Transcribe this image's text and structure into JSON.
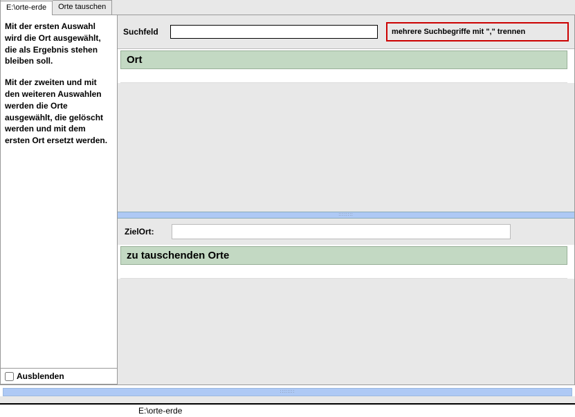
{
  "tabs": {
    "tab1": "E:\\orte-erde",
    "tab2": "Orte tauschen"
  },
  "left": {
    "para1": "Mit der ersten Auswahl wird die Ort ausgewählt, die als Ergebnis stehen bleiben soll.",
    "para2": "Mit der zweiten und mit den weiteren Auswahlen werden die Orte ausgewählt, die gelöscht werden und mit dem ersten Ort ersetzt werden.",
    "ausblenden": "Ausblenden"
  },
  "search": {
    "label": "Suchfeld",
    "value": "",
    "hint": "mehrere Suchbegriffe mit \",\" trennen"
  },
  "sections": {
    "ort": "Ort",
    "zielort_label": "ZielOrt:",
    "zielort_value": "",
    "zu_tauschen": "zu tauschenden Orte"
  },
  "statusbar": {
    "path": "E:\\orte-erde"
  },
  "splitter_dots": "::::::::"
}
